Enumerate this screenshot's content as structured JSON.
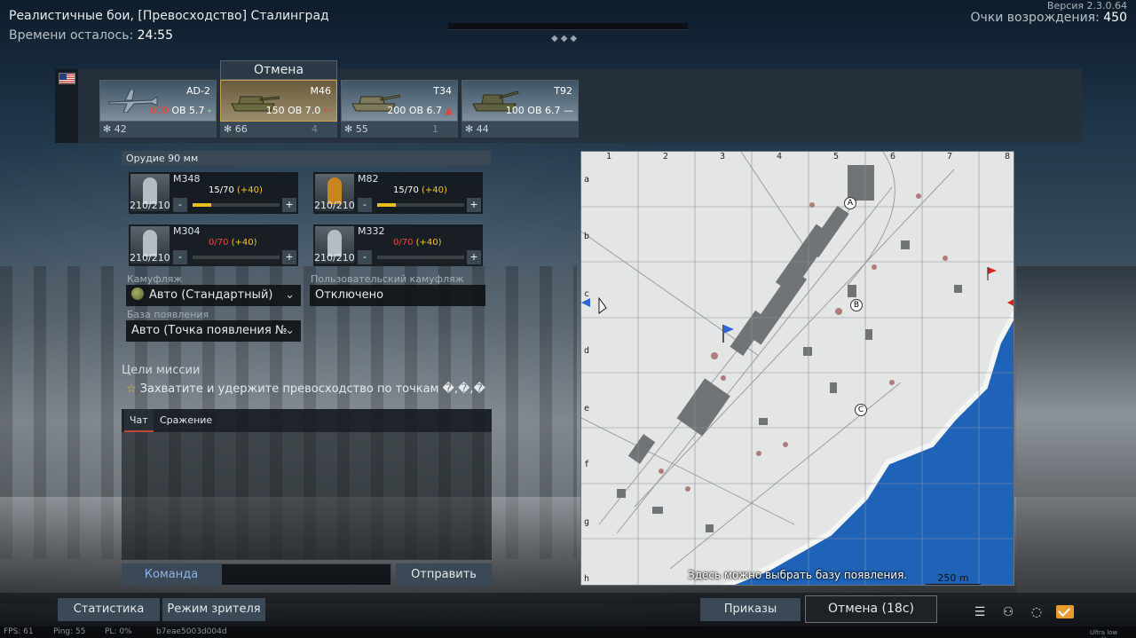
{
  "mission": {
    "title": "Реалистичные бои, [Превосходство] Сталинград",
    "time_left_label": "Времени осталось:",
    "time_left_value": "24:55",
    "version": "Версия 2.3.0.64",
    "respawn_label": "Очки возрождения:",
    "respawn_value": "450"
  },
  "vehicles": {
    "cancel_tab": "Отмена",
    "items": [
      {
        "name": "AD-2",
        "cost": "600",
        "cost_rest": " ОВ 5.7",
        "br_marker": "⬩",
        "count": "42",
        "reserve": ""
      },
      {
        "name": "M46",
        "cost": "150",
        "cost_rest": " ОВ 7.0",
        "br_marker": "⌐",
        "count": "66",
        "reserve": "4"
      },
      {
        "name": "T34",
        "cost": "200",
        "cost_rest": " ОВ 6.7",
        "br_marker": "▲",
        "count": "55",
        "reserve": "1"
      },
      {
        "name": "T92",
        "cost": "100",
        "cost_rest": " ОВ 6.7",
        "br_marker": "—",
        "count": "44",
        "reserve": ""
      }
    ]
  },
  "ammo": {
    "header": "Орудие 90 мм",
    "shells": [
      {
        "name": "M348",
        "stock": "210/210",
        "count": "15/70",
        "bonus": "(+40)",
        "fill": 0.21
      },
      {
        "name": "M82",
        "stock": "210/210",
        "count": "15/70",
        "bonus": "(+40)",
        "fill": 0.21
      },
      {
        "name": "M304",
        "stock": "210/210",
        "count": "0/70",
        "bonus": "(+40)",
        "fill": 0.0
      },
      {
        "name": "M332",
        "stock": "210/210",
        "count": "0/70",
        "bonus": "(+40)",
        "fill": 0.0
      }
    ]
  },
  "camo": {
    "label": "Камуфляж",
    "value": "Авто (Стандартный)",
    "custom_label": "Пользовательский камуфляж",
    "custom_value": "Отключено",
    "spawn_label": "База появления",
    "spawn_value": "Авто (Точка появления №"
  },
  "objectives": {
    "title": "Цели миссии",
    "text": "Захватите и удержите превосходство по точкам �,�,�"
  },
  "chat": {
    "tab_chat": "Чат",
    "tab_battle": "Сражение",
    "team_button": "Команда",
    "send_button": "Отправить"
  },
  "map": {
    "columns": [
      "1",
      "2",
      "3",
      "4",
      "5",
      "6",
      "7",
      "8"
    ],
    "rows": [
      "a",
      "b",
      "c",
      "d",
      "e",
      "f",
      "g",
      "h"
    ],
    "hint": "Здесь можно выбрать базу появления.",
    "scale": "250 m",
    "points": [
      "A",
      "B",
      "C"
    ]
  },
  "bottom": {
    "stats_button": "Статистика",
    "spectator_button": "Режим зрителя",
    "orders_button": "Приказы",
    "cancel_button": "Отмена (18с)"
  },
  "status": {
    "fps": "FPS: 61",
    "ping": "Ping: 55",
    "pl": "PL: 0%",
    "session": "b7eae5003d004d",
    "quality": "Ultra low quality"
  },
  "colors": {
    "accent_red": "#e0473a",
    "accent_yellow": "#f1c43d",
    "sea": "#1f63b8"
  }
}
